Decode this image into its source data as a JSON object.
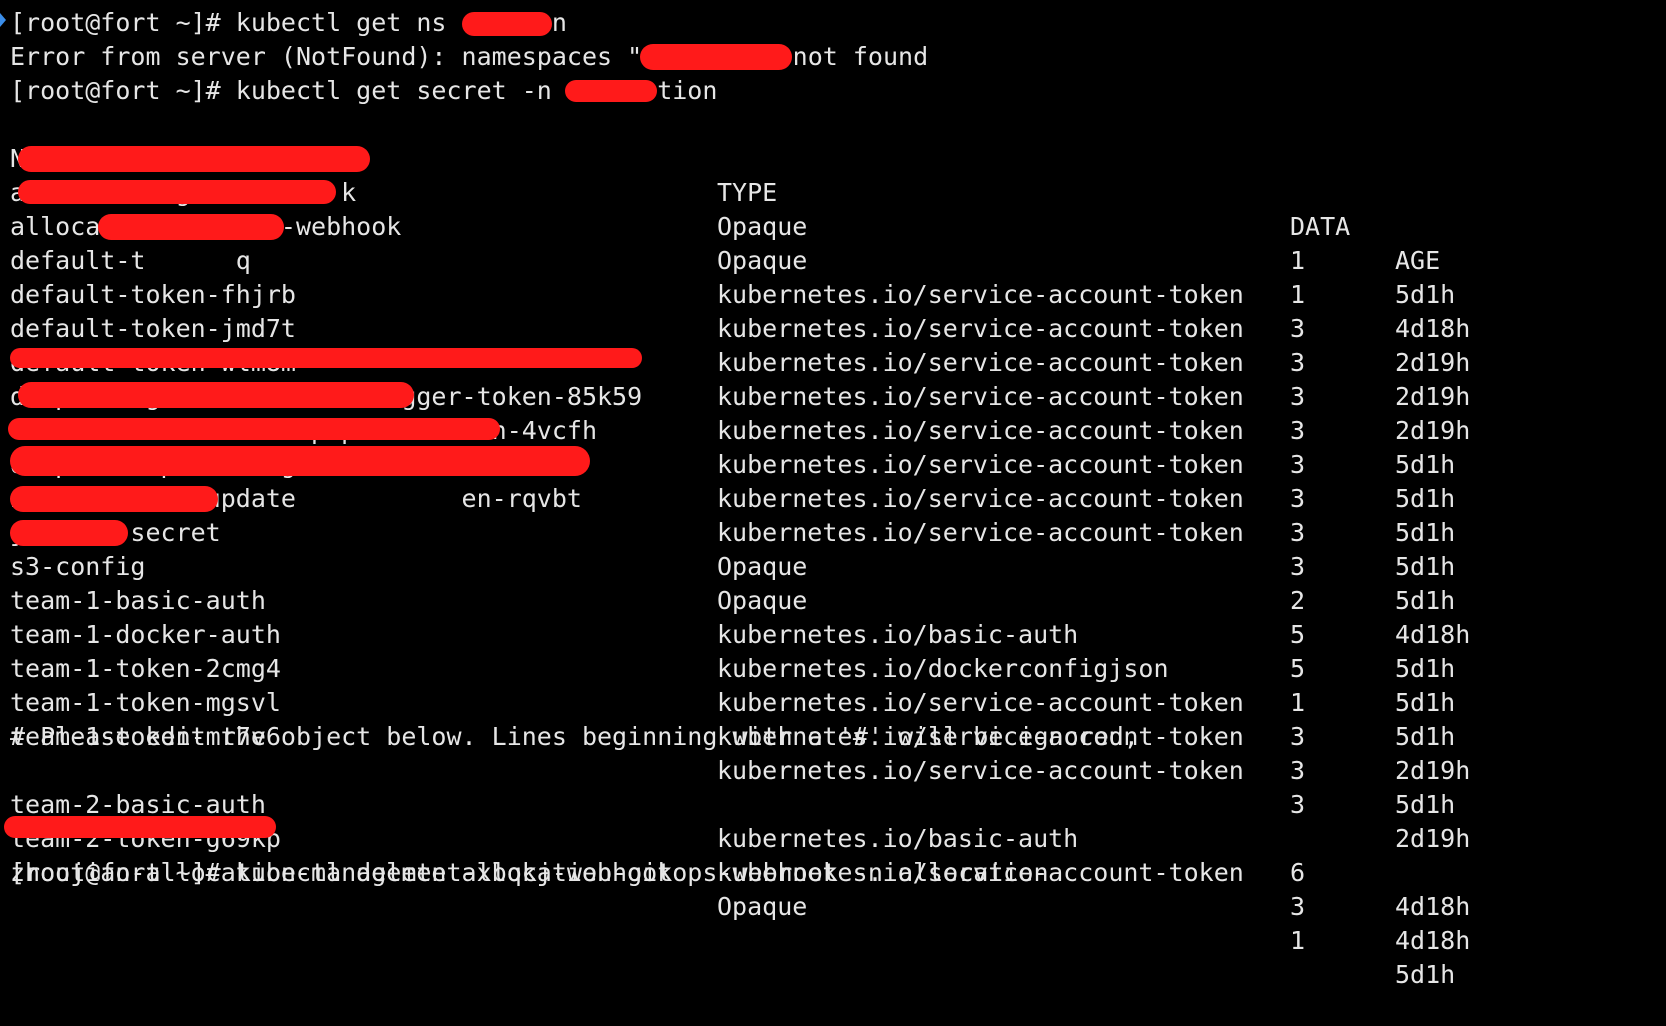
{
  "terminal": {
    "background": "#000000",
    "text_color": "#e6e6e6",
    "redaction_color": "#ff1a1a",
    "lines": {
      "cmd_get_ns": "[root@fort ~]# kubectl get ns al tion",
      "error": "Error from server (NotFound): namespaces \"all     \" not found",
      "cmd_get_secret": "[root@fort ~]# kubectl get secret -n alloc tion",
      "comment": "# Please edit the object below. Lines beginning with a '#' will be ignored,",
      "cmd_delete": "[root@fort ~]# kubectl delete allocation-gitops-webhook -n allocation"
    },
    "table": {
      "headers": {
        "name": "NAME",
        "type": "TYPE",
        "data": "DATA",
        "age": "AGE"
      },
      "rows": [
        {
          "name": "allocation-gi         k",
          "type": "Opaque",
          "data": "1",
          "age": "5d1h"
        },
        {
          "name": "allocation-git   2-webhook",
          "type": "Opaque",
          "data": "1",
          "age": "4d18h"
        },
        {
          "name": "default-t      q",
          "type": "kubernetes.io/service-account-token",
          "data": "3",
          "age": "2d19h"
        },
        {
          "name": "default-token-fhjrb",
          "type": "kubernetes.io/service-account-token",
          "data": "3",
          "age": "2d19h"
        },
        {
          "name": "default-token-jmd7t",
          "type": "kubernetes.io/service-account-token",
          "data": "3",
          "age": "2d19h"
        },
        {
          "name": "default-token-wlm8m",
          "type": "kubernetes.io/service-account-token",
          "data": "3",
          "age": "5d1h"
        },
        {
          "name": "dispatch-generate-cron-trigger-token-85k59",
          "type": "kubernetes.io/service-account-token",
          "data": "3",
          "age": "5d1h"
        },
        {
          "name": "d                   pipeli  token-4vcfh",
          "type": "kubernetes.io/service-account-token",
          "data": "3",
          "age": "5d1h"
        },
        {
          "name": "dispatch-upload-log               ",
          "type": "kubernetes.io/service-account-token",
          "data": "3",
          "age": "5d1h"
        },
        {
          "name": "image-digest-update           en-rqvbt",
          "type": "kubernetes.io/service-account-token",
          "data": "3",
          "age": "5d1h"
        },
        {
          "name": "jenkins-secret",
          "type": "Opaque",
          "data": "2",
          "age": "4d18h"
        },
        {
          "name": "s3-config",
          "type": "Opaque",
          "data": "5",
          "age": "5d1h"
        },
        {
          "name": "team-1-basic-auth",
          "type": "kubernetes.io/basic-auth",
          "data": "5",
          "age": "5d1h"
        },
        {
          "name": "team-1-docker-auth",
          "type": "kubernetes.io/dockerconfigjson",
          "data": "1",
          "age": "5d1h"
        },
        {
          "name": "team-1-token-2cmg4",
          "type": "kubernetes.io/service-account-token",
          "data": "3",
          "age": "2d19h"
        },
        {
          "name": "team-1-token-mgsvl",
          "type": "kubernetes.io/service-account-token",
          "data": "3",
          "age": "5d1h"
        },
        {
          "name": "team-1-token-mr7v6",
          "type": "kubernetes.io/service-account-token",
          "data": "3",
          "age": "2d19h"
        }
      ],
      "rows_after_comment": [
        {
          "name": "team-2-basic-auth",
          "type": "kubernetes.io/basic-auth",
          "data": "6",
          "age": "4d18h"
        },
        {
          "name": "team-2-token-g69kp",
          "type": "kubernetes.io/service-account-token",
          "data": "3",
          "age": "4d18h"
        },
        {
          "name": "zhoujian-allocation-management-xbqkj-webhook",
          "type": "Opaque",
          "data": "1",
          "age": "5d1h"
        }
      ]
    }
  }
}
